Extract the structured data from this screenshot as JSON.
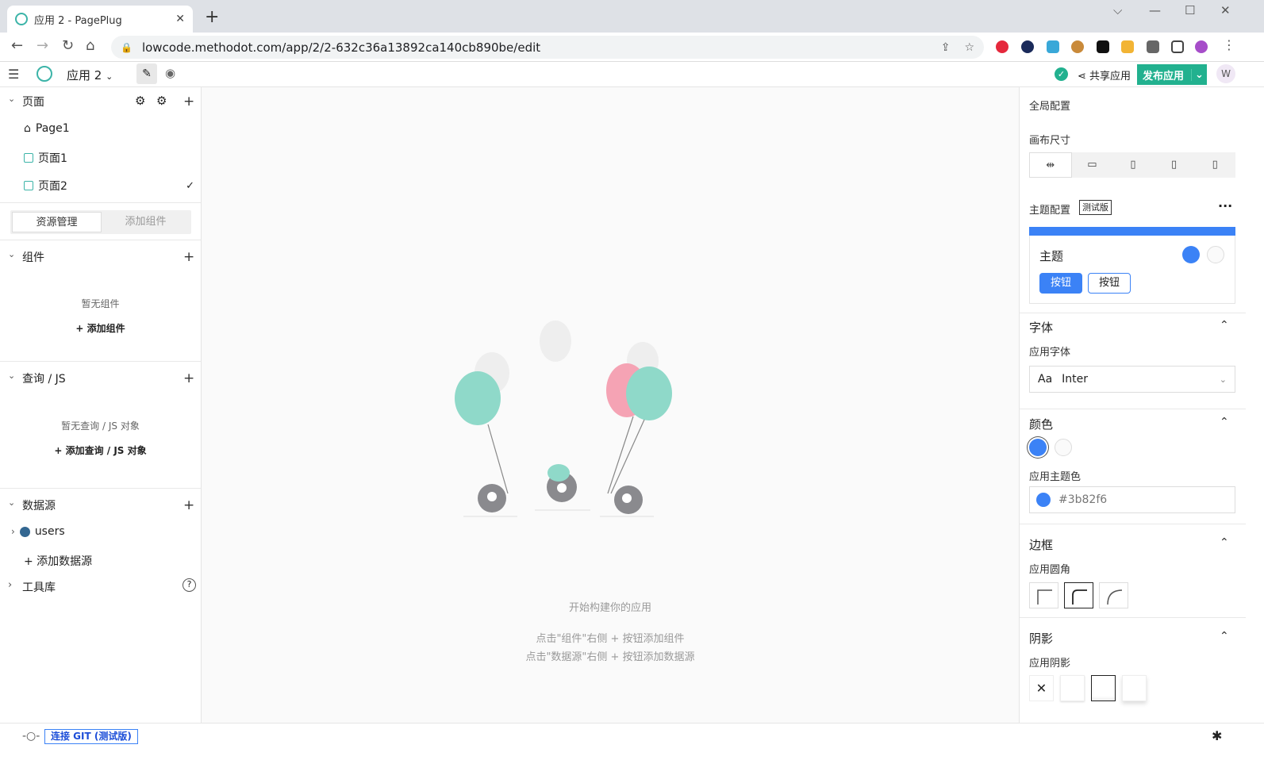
{
  "browser": {
    "tab_title": "应用 2 - PagePlug",
    "tab_close": "✕",
    "new_tab": "+",
    "url": "lowcode.methodot.com/app/2/2-632c36a13892ca140cb890be/edit",
    "window_controls": [
      "⌵",
      "—",
      "☐",
      "✕"
    ]
  },
  "header": {
    "app_name": "应用 2",
    "share_label": "共享应用",
    "publish_label": "发布应用",
    "avatar_letter": "W"
  },
  "pages": {
    "title": "页面",
    "items": [
      {
        "label": "Page1",
        "icon": "home-icon"
      },
      {
        "label": "页面1",
        "icon": "page-icon"
      },
      {
        "label": "页面2",
        "icon": "page-icon"
      }
    ]
  },
  "explorer_tabs": [
    "资源管理",
    "添加组件"
  ],
  "widgets": {
    "title": "组件",
    "empty": "暂无组件",
    "add": "+ 添加组件"
  },
  "queries": {
    "title": "查询 / JS",
    "empty": "暂无查询 / JS 对象",
    "add": "+ 添加查询 / JS 对象"
  },
  "datasources": {
    "title": "数据源",
    "items": [
      {
        "label": "users",
        "icon": "postgres-icon"
      }
    ],
    "add": "+ 添加数据源"
  },
  "toolbox": {
    "title": "工具库"
  },
  "canvas": {
    "title": "开始构建你的应用",
    "hint1": "点击\"组件\"右侧 + 按钮添加组件",
    "hint2": "点击\"数据源\"右侧 + 按钮添加数据源"
  },
  "props": {
    "global_title": "全局配置",
    "canvas_size": "画布尺寸",
    "theme_config": "主题配置",
    "beta": "测试版",
    "theme_name": "主题",
    "btn1": "按钮",
    "btn2": "按钮",
    "font_section": "字体",
    "app_font": "应用字体",
    "font_aa": "Aa",
    "font_value": "Inter",
    "color_section": "颜色",
    "primary_color_label": "应用主题色",
    "primary_color_value": "#3b82f6",
    "border_section": "边框",
    "radius_label": "应用圆角",
    "shadow_section": "阴影",
    "shadow_label": "应用阴影",
    "shadow_none": "✕"
  },
  "colors": {
    "primary": "#3b82f6",
    "accent": "#22b18f",
    "balloon_teal": "#8fd9c9",
    "balloon_pink": "#f5a3b4"
  },
  "footer": {
    "git_label": "连接 GIT (测试版)"
  }
}
